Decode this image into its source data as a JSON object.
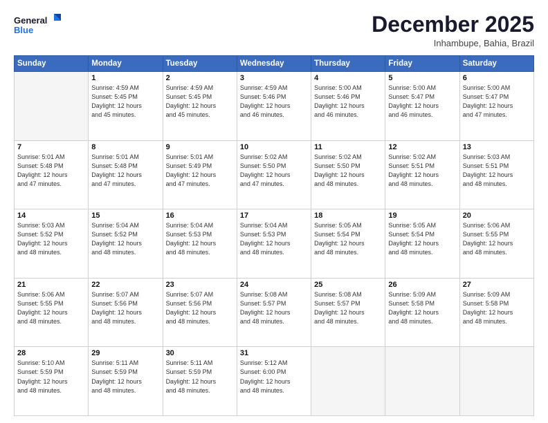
{
  "header": {
    "logo_line1": "General",
    "logo_line2": "Blue",
    "title": "December 2025",
    "subtitle": "Inhambupe, Bahia, Brazil"
  },
  "calendar": {
    "days_of_week": [
      "Sunday",
      "Monday",
      "Tuesday",
      "Wednesday",
      "Thursday",
      "Friday",
      "Saturday"
    ],
    "weeks": [
      [
        {
          "day": "",
          "info": ""
        },
        {
          "day": "1",
          "info": "Sunrise: 4:59 AM\nSunset: 5:45 PM\nDaylight: 12 hours\nand 45 minutes."
        },
        {
          "day": "2",
          "info": "Sunrise: 4:59 AM\nSunset: 5:45 PM\nDaylight: 12 hours\nand 45 minutes."
        },
        {
          "day": "3",
          "info": "Sunrise: 4:59 AM\nSunset: 5:46 PM\nDaylight: 12 hours\nand 46 minutes."
        },
        {
          "day": "4",
          "info": "Sunrise: 5:00 AM\nSunset: 5:46 PM\nDaylight: 12 hours\nand 46 minutes."
        },
        {
          "day": "5",
          "info": "Sunrise: 5:00 AM\nSunset: 5:47 PM\nDaylight: 12 hours\nand 46 minutes."
        },
        {
          "day": "6",
          "info": "Sunrise: 5:00 AM\nSunset: 5:47 PM\nDaylight: 12 hours\nand 47 minutes."
        }
      ],
      [
        {
          "day": "7",
          "info": "Sunrise: 5:01 AM\nSunset: 5:48 PM\nDaylight: 12 hours\nand 47 minutes."
        },
        {
          "day": "8",
          "info": "Sunrise: 5:01 AM\nSunset: 5:48 PM\nDaylight: 12 hours\nand 47 minutes."
        },
        {
          "day": "9",
          "info": "Sunrise: 5:01 AM\nSunset: 5:49 PM\nDaylight: 12 hours\nand 47 minutes."
        },
        {
          "day": "10",
          "info": "Sunrise: 5:02 AM\nSunset: 5:50 PM\nDaylight: 12 hours\nand 47 minutes."
        },
        {
          "day": "11",
          "info": "Sunrise: 5:02 AM\nSunset: 5:50 PM\nDaylight: 12 hours\nand 48 minutes."
        },
        {
          "day": "12",
          "info": "Sunrise: 5:02 AM\nSunset: 5:51 PM\nDaylight: 12 hours\nand 48 minutes."
        },
        {
          "day": "13",
          "info": "Sunrise: 5:03 AM\nSunset: 5:51 PM\nDaylight: 12 hours\nand 48 minutes."
        }
      ],
      [
        {
          "day": "14",
          "info": "Sunrise: 5:03 AM\nSunset: 5:52 PM\nDaylight: 12 hours\nand 48 minutes."
        },
        {
          "day": "15",
          "info": "Sunrise: 5:04 AM\nSunset: 5:52 PM\nDaylight: 12 hours\nand 48 minutes."
        },
        {
          "day": "16",
          "info": "Sunrise: 5:04 AM\nSunset: 5:53 PM\nDaylight: 12 hours\nand 48 minutes."
        },
        {
          "day": "17",
          "info": "Sunrise: 5:04 AM\nSunset: 5:53 PM\nDaylight: 12 hours\nand 48 minutes."
        },
        {
          "day": "18",
          "info": "Sunrise: 5:05 AM\nSunset: 5:54 PM\nDaylight: 12 hours\nand 48 minutes."
        },
        {
          "day": "19",
          "info": "Sunrise: 5:05 AM\nSunset: 5:54 PM\nDaylight: 12 hours\nand 48 minutes."
        },
        {
          "day": "20",
          "info": "Sunrise: 5:06 AM\nSunset: 5:55 PM\nDaylight: 12 hours\nand 48 minutes."
        }
      ],
      [
        {
          "day": "21",
          "info": "Sunrise: 5:06 AM\nSunset: 5:55 PM\nDaylight: 12 hours\nand 48 minutes."
        },
        {
          "day": "22",
          "info": "Sunrise: 5:07 AM\nSunset: 5:56 PM\nDaylight: 12 hours\nand 48 minutes."
        },
        {
          "day": "23",
          "info": "Sunrise: 5:07 AM\nSunset: 5:56 PM\nDaylight: 12 hours\nand 48 minutes."
        },
        {
          "day": "24",
          "info": "Sunrise: 5:08 AM\nSunset: 5:57 PM\nDaylight: 12 hours\nand 48 minutes."
        },
        {
          "day": "25",
          "info": "Sunrise: 5:08 AM\nSunset: 5:57 PM\nDaylight: 12 hours\nand 48 minutes."
        },
        {
          "day": "26",
          "info": "Sunrise: 5:09 AM\nSunset: 5:58 PM\nDaylight: 12 hours\nand 48 minutes."
        },
        {
          "day": "27",
          "info": "Sunrise: 5:09 AM\nSunset: 5:58 PM\nDaylight: 12 hours\nand 48 minutes."
        }
      ],
      [
        {
          "day": "28",
          "info": "Sunrise: 5:10 AM\nSunset: 5:59 PM\nDaylight: 12 hours\nand 48 minutes."
        },
        {
          "day": "29",
          "info": "Sunrise: 5:11 AM\nSunset: 5:59 PM\nDaylight: 12 hours\nand 48 minutes."
        },
        {
          "day": "30",
          "info": "Sunrise: 5:11 AM\nSunset: 5:59 PM\nDaylight: 12 hours\nand 48 minutes."
        },
        {
          "day": "31",
          "info": "Sunrise: 5:12 AM\nSunset: 6:00 PM\nDaylight: 12 hours\nand 48 minutes."
        },
        {
          "day": "",
          "info": ""
        },
        {
          "day": "",
          "info": ""
        },
        {
          "day": "",
          "info": ""
        }
      ]
    ]
  }
}
